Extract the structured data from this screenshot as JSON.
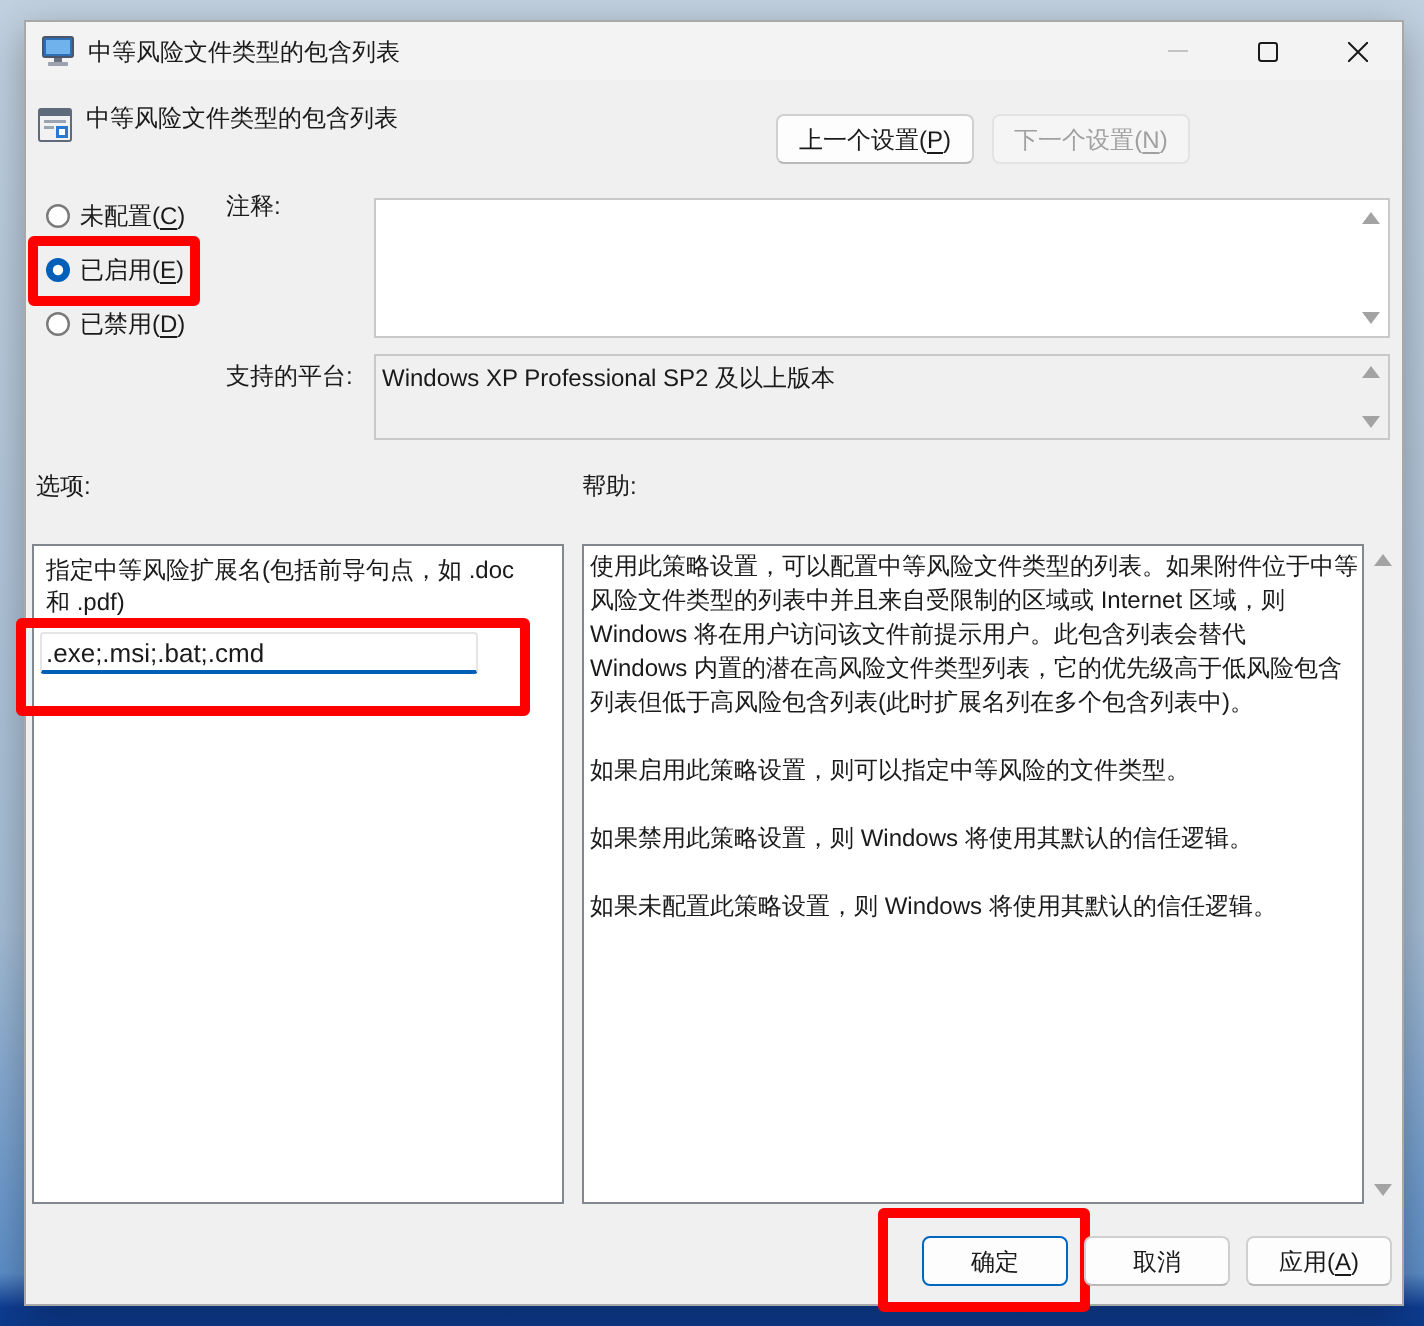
{
  "window": {
    "title": "中等风险文件类型的包含列表",
    "controls": [
      {
        "kind": "minimize",
        "disabled": true
      },
      {
        "kind": "maximize",
        "disabled": false
      },
      {
        "kind": "close",
        "disabled": false
      }
    ]
  },
  "header": {
    "title": "中等风险文件类型的包含列表",
    "buttons": [
      {
        "text": "上一个设置(",
        "hotkey": "P",
        "suffix": ")",
        "disabled": false
      },
      {
        "text": "下一个设置(",
        "hotkey": "N",
        "suffix": ")",
        "disabled": true
      }
    ]
  },
  "state_options": [
    {
      "text": "未配置(",
      "hotkey": "C",
      "suffix": ")",
      "selected": false,
      "highlighted": false
    },
    {
      "text": "已启用(",
      "hotkey": "E",
      "suffix": ")",
      "selected": true,
      "highlighted": true
    },
    {
      "text": "已禁用(",
      "hotkey": "D",
      "suffix": ")",
      "selected": false,
      "highlighted": false
    }
  ],
  "comment": {
    "label": "注释:"
  },
  "platform": {
    "label": "支持的平台:",
    "value": "Windows XP Professional SP2 及以上版本"
  },
  "options": {
    "label": "选项:",
    "description": "指定中等风险扩展名(包括前导句点，如 .doc 和 .pdf)",
    "input": {
      "value": ".exe;.msi;.bat;.cmd",
      "highlighted": true
    }
  },
  "help": {
    "label": "帮助:",
    "paragraphs": [
      {
        "lines": [
          "使用此策略设置，可以配置中等风险文件类型的列表。如果附件位于中等",
          "风险文件类型的列表中并且来自受限制的区域或 Internet 区域，则",
          "Windows 将在用户访问该文件前提示用户。此包含列表会替代",
          "Windows 内置的潜在高风险文件类型列表，它的优先级高于低风险包含",
          "列表但低于高风险包含列表(此时扩展名列在多个包含列表中)。"
        ]
      },
      {
        "lines": [
          "如果启用此策略设置，则可以指定中等风险的文件类型。"
        ]
      },
      {
        "lines": [
          "如果禁用此策略设置，则 Windows 将使用其默认的信任逻辑。"
        ]
      },
      {
        "lines": [
          "如果未配置此策略设置，则 Windows 将使用其默认的信任逻辑。"
        ]
      }
    ]
  },
  "buttons": [
    {
      "text": "确定",
      "default": true,
      "highlighted": true
    },
    {
      "text": "取消",
      "default": false,
      "highlighted": false
    },
    {
      "text": "应用(",
      "hotkey": "A",
      "suffix": ")",
      "default": false,
      "highlighted": false
    }
  ]
}
